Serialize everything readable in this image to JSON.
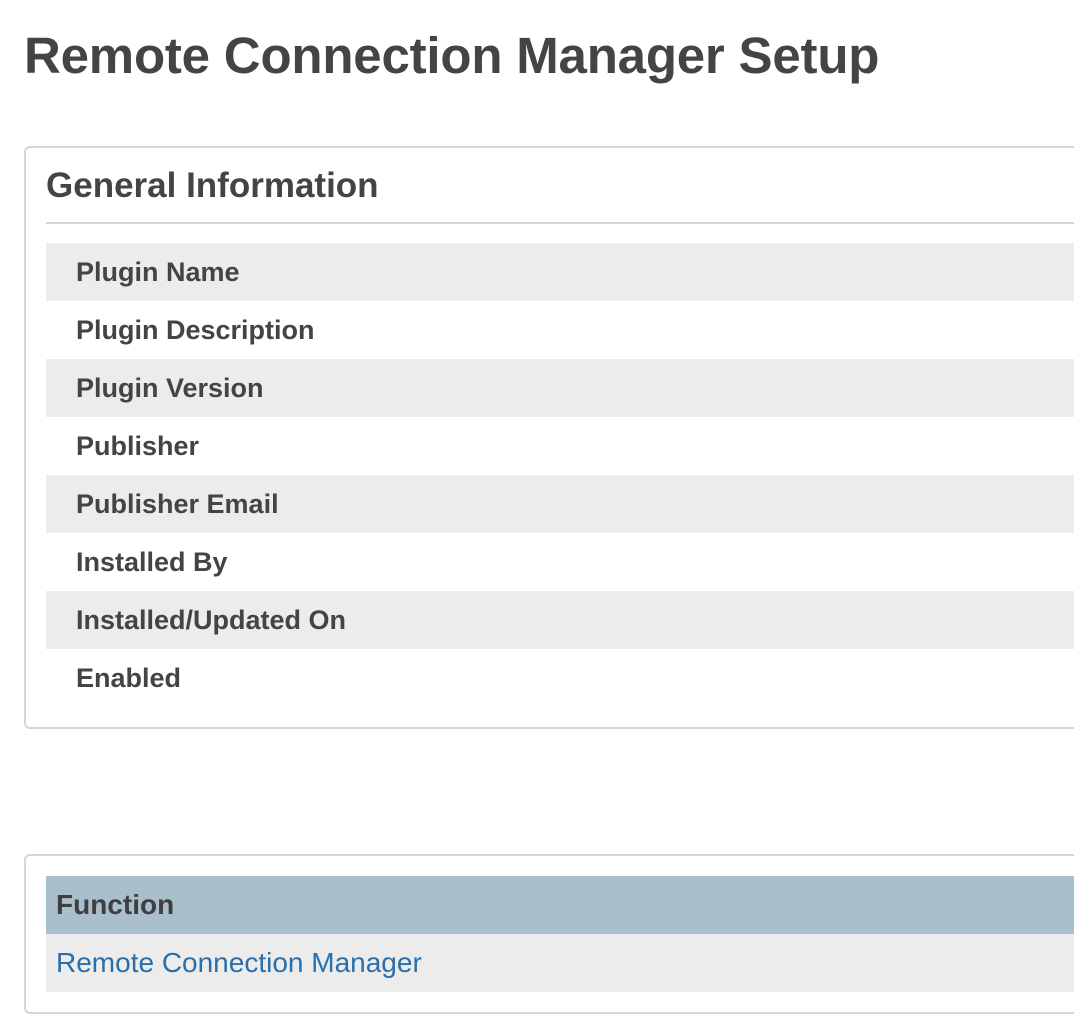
{
  "page": {
    "title": "Remote Connection Manager Setup"
  },
  "general_info": {
    "heading": "General Information",
    "rows": [
      {
        "label": "Plugin Name"
      },
      {
        "label": "Plugin Description"
      },
      {
        "label": "Plugin Version"
      },
      {
        "label": "Publisher"
      },
      {
        "label": "Publisher Email"
      },
      {
        "label": "Installed By"
      },
      {
        "label": "Installed/Updated On"
      },
      {
        "label": "Enabled"
      }
    ]
  },
  "functions": {
    "column_header": "Function",
    "rows": [
      {
        "name": "Remote Connection Manager"
      }
    ]
  },
  "colors": {
    "text": "#444444",
    "row_alt": "#ececec",
    "table_header": "#a9bfcb",
    "link": "#2a6fa8",
    "border": "#d6d6d6"
  }
}
